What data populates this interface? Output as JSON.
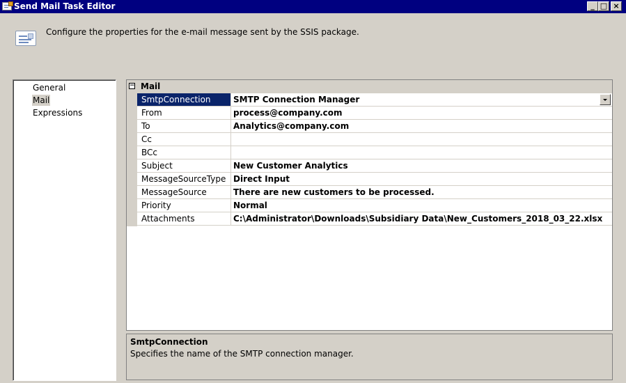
{
  "window": {
    "title": "Send Mail Task Editor"
  },
  "header": {
    "description": "Configure the properties for the e-mail message sent by the SSIS package.",
    "icon": "mail-message-icon"
  },
  "nav": {
    "items": [
      {
        "label": "General",
        "selected": false
      },
      {
        "label": "Mail",
        "selected": true
      },
      {
        "label": "Expressions",
        "selected": false
      }
    ]
  },
  "grid": {
    "category": {
      "toggle": "⊟",
      "label": "Mail"
    },
    "properties": [
      {
        "name": "SmtpConnection",
        "value": "SMTP Connection Manager",
        "selected": true,
        "dropdown": true
      },
      {
        "name": "From",
        "value": "process@company.com"
      },
      {
        "name": "To",
        "value": "Analytics@company.com"
      },
      {
        "name": "Cc",
        "value": ""
      },
      {
        "name": "BCc",
        "value": ""
      },
      {
        "name": "Subject",
        "value": "New Customer Analytics"
      },
      {
        "name": "MessageSourceType",
        "value": "Direct Input"
      },
      {
        "name": "MessageSource",
        "value": "There are new customers to be processed."
      },
      {
        "name": "Priority",
        "value": "Normal"
      },
      {
        "name": "Attachments",
        "value": "C:\\Administrator\\Downloads\\Subsidiary Data\\New_Customers_2018_03_22.xlsx"
      }
    ]
  },
  "description_panel": {
    "title": "SmtpConnection",
    "text": "Specifies the name of the SMTP connection manager."
  },
  "colors": {
    "titlebar": "#000080",
    "selection": "#0a246a",
    "face": "#d4d0c8"
  }
}
